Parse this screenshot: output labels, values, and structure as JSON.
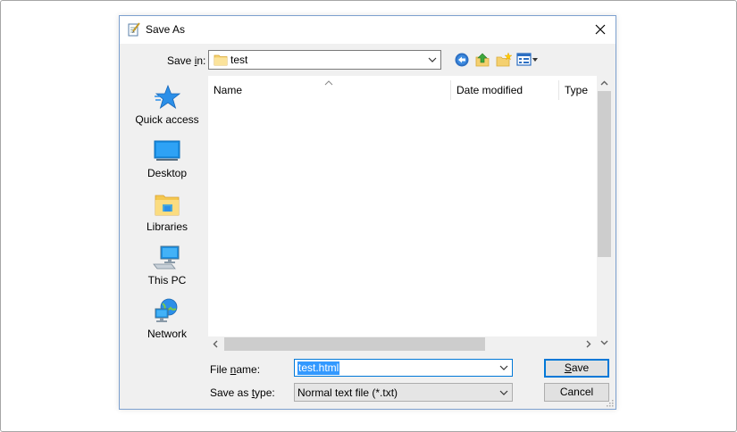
{
  "dialog": {
    "title": "Save As",
    "close_icon": "close-icon"
  },
  "toolbar": {
    "lookin_label_pre": "Save ",
    "lookin_label_accel": "i",
    "lookin_label_post": "n:",
    "lookin_value": "test",
    "icons": [
      "back-icon",
      "up-folder-icon",
      "new-folder-icon",
      "view-menu-icon"
    ]
  },
  "places": [
    {
      "label": "Quick access",
      "icon": "quick-access-star-icon"
    },
    {
      "label": "Desktop",
      "icon": "desktop-icon"
    },
    {
      "label": "Libraries",
      "icon": "libraries-icon"
    },
    {
      "label": "This PC",
      "icon": "this-pc-icon"
    },
    {
      "label": "Network",
      "icon": "network-icon"
    }
  ],
  "filelist": {
    "columns": [
      "Name",
      "Date modified",
      "Type"
    ],
    "rows": []
  },
  "form": {
    "filename_label_pre": "File ",
    "filename_label_accel": "n",
    "filename_label_post": "ame:",
    "filename_value": "test.html",
    "filetype_label_pre": "Save as ",
    "filetype_label_accel": "t",
    "filetype_label_post": "ype:",
    "filetype_value": "Normal text file (*.txt)"
  },
  "buttons": {
    "save_accel": "S",
    "save_rest": "ave",
    "cancel": "Cancel"
  },
  "colors": {
    "accent": "#0078d7",
    "selection": "#3399ff",
    "dialog_bg": "#f0f0f0",
    "border": "#7ca0cf"
  }
}
